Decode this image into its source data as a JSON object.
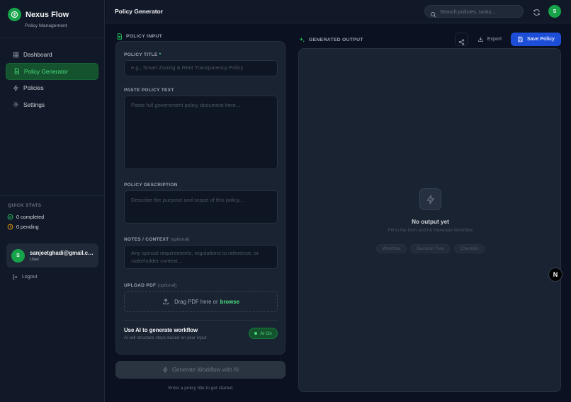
{
  "brand": {
    "name": "Nexus Flow",
    "subtitle": "Policy Management"
  },
  "sidebar": {
    "items": [
      {
        "label": "Dashboard",
        "icon": "grid-icon"
      },
      {
        "label": "Policy Generator",
        "icon": "document-icon",
        "active": true
      },
      {
        "label": "Policies",
        "icon": "bolt-icon"
      },
      {
        "label": "Settings",
        "icon": "gear-icon"
      }
    ],
    "quick_stats": {
      "title": "QUICK STATS",
      "completed": "0 completed",
      "pending": "0 pending"
    },
    "user": {
      "initial": "S",
      "email": "sanjeetghadi@gmail.com",
      "role": "User"
    },
    "logout": "Logout"
  },
  "header": {
    "title": "Policy Generator",
    "search_placeholder": "Search policies, tasks...",
    "avatar_initial": "S"
  },
  "input": {
    "section_title": "POLICY INPUT",
    "title_label": "POLICY TITLE",
    "title_required": "*",
    "title_placeholder": "e.g., Smart Zoning & Rent Transparency Policy",
    "text_label": "PASTE POLICY TEXT",
    "text_placeholder": "Paste full government policy document here...",
    "desc_label": "POLICY DESCRIPTION",
    "desc_placeholder": "Describe the purpose and scope of this policy...",
    "notes_label": "NOTES / CONTEXT",
    "notes_optional": "(optional)",
    "notes_placeholder": "Any special requirements, regulations to reference, or stakeholder context...",
    "upload_label": "UPLOAD PDF",
    "upload_optional": "(optional)",
    "upload_text": "Drag PDF here or",
    "upload_browse": "browse",
    "ai_title": "Use AI to generate workflow",
    "ai_sub": "AI will structure steps based on your input",
    "ai_toggle": "AI On",
    "generate_label": "Generate Workflow with AI",
    "hint": "Enter a policy title to get started"
  },
  "output": {
    "section_title": "GENERATED OUTPUT",
    "export_label": "Export",
    "save_label": "Save Policy",
    "empty_title": "No output yet",
    "empty_sub": "Fill in the form and hit Generate Workflow",
    "chips": [
      "Workflow",
      "Decision Tree",
      "Checklist"
    ]
  },
  "floating_badge": "N",
  "colors": {
    "accent": "#16a34a",
    "accent_text": "#4ade80",
    "primary": "#1d4ed8",
    "bg": "#0b1120",
    "panel": "#1a2332"
  }
}
